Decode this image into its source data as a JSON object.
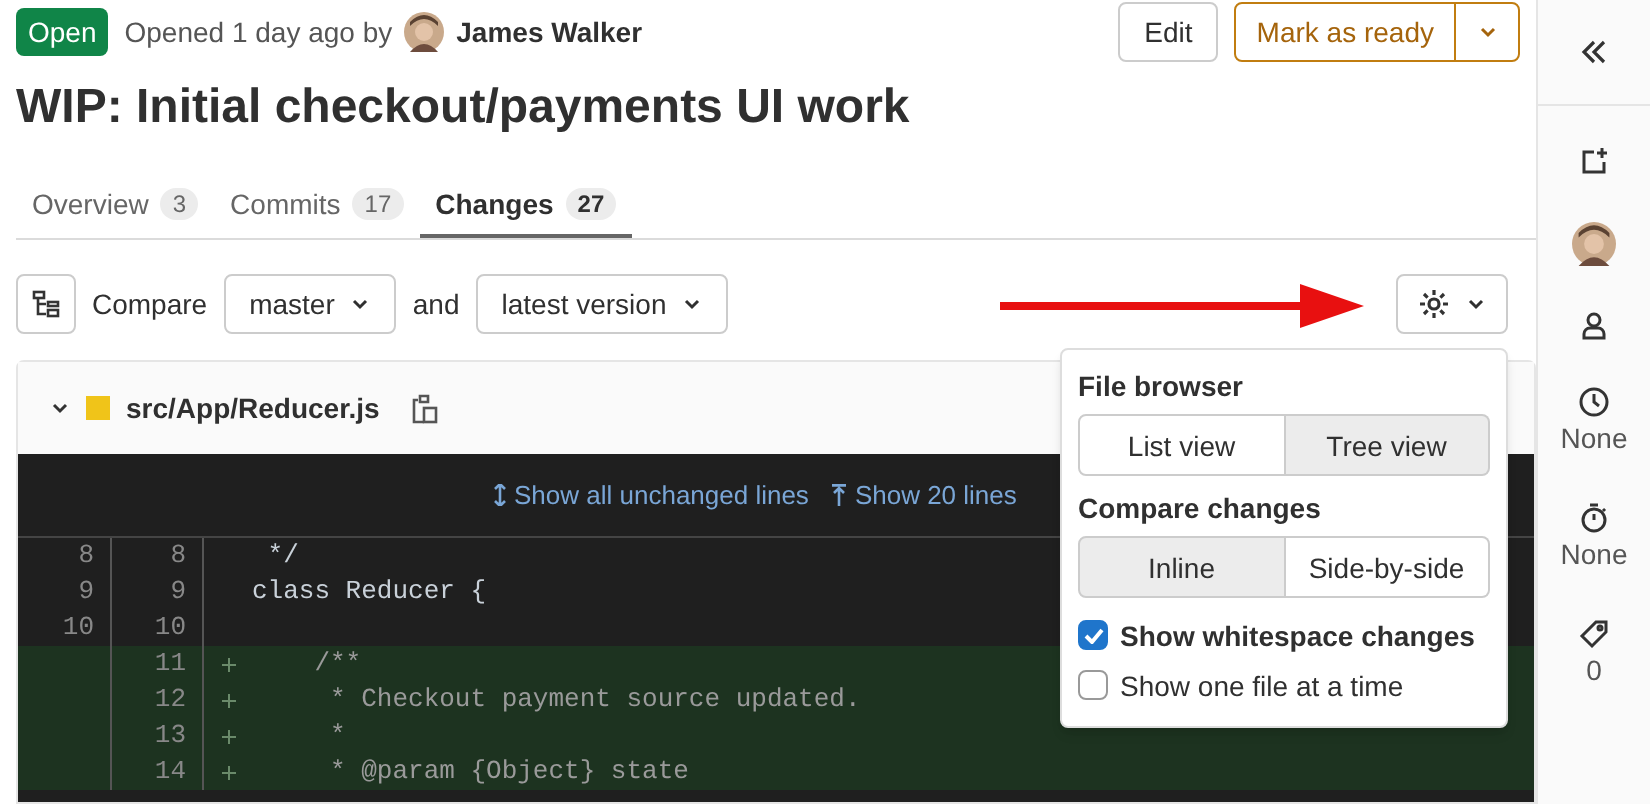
{
  "header": {
    "status": "Open",
    "opened": "Opened 1 day ago by",
    "author": "James Walker",
    "buttons": {
      "edit": "Edit",
      "ready": "Mark as ready"
    }
  },
  "title": "WIP: Initial checkout/payments UI work",
  "tabs": [
    {
      "label": "Overview",
      "count": "3",
      "selected": false
    },
    {
      "label": "Commits",
      "count": "17",
      "selected": false
    },
    {
      "label": "Changes",
      "count": "27",
      "selected": true
    }
  ],
  "compare": {
    "label": "Compare",
    "base": "master",
    "and": "and",
    "target": "latest version"
  },
  "file": {
    "path": "src/App/Reducer.js",
    "expanded": true,
    "expanders": [
      "Show all unchanged lines",
      "Show 20 lines"
    ],
    "lines": [
      {
        "kind": "context",
        "old": "8",
        "new": "8",
        "code": " */"
      },
      {
        "kind": "context",
        "old": "9",
        "new": "9",
        "code": "class Reducer {"
      },
      {
        "kind": "context",
        "old": "10",
        "new": "10"
      },
      {
        "kind": "added",
        "new": "11",
        "code": "    /**"
      },
      {
        "kind": "added",
        "new": "12",
        "code": "     * Checkout payment source updated."
      },
      {
        "kind": "added",
        "new": "13",
        "code": "     *"
      },
      {
        "kind": "added",
        "new": "14",
        "code": "     * @param {Object} state"
      }
    ]
  },
  "settings": {
    "sections": [
      {
        "heading": "File browser",
        "options": [
          {
            "label": "List view",
            "selected": false
          },
          {
            "label": "Tree view",
            "selected": true
          }
        ]
      },
      {
        "heading": "Compare changes",
        "options": [
          {
            "label": "Inline",
            "selected": true
          },
          {
            "label": "Side-by-side",
            "selected": false
          }
        ]
      }
    ],
    "checkboxes": [
      {
        "label": "Show whitespace changes",
        "checked": true
      },
      {
        "label": "Show one file at a time",
        "checked": false
      }
    ]
  },
  "sidebar": [
    {
      "kind": "todo"
    },
    {
      "kind": "avatar"
    },
    {
      "kind": "person"
    },
    {
      "kind": "clock",
      "text": "None"
    },
    {
      "kind": "timer",
      "text": "None"
    },
    {
      "kind": "tag",
      "text": "0"
    }
  ]
}
